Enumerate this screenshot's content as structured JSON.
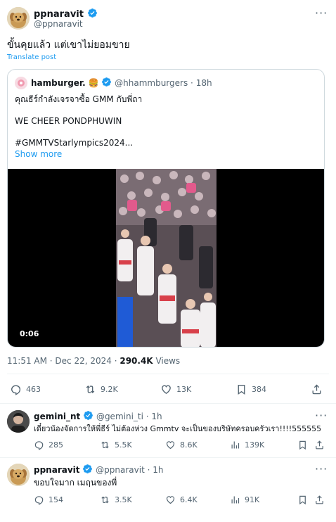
{
  "main_post": {
    "display_name": "ppnaravit",
    "handle": "@ppnaravit",
    "text": "ขั้นคุยแล้ว แต่เขาไม่ยอมขาย",
    "translate_label": "Translate post",
    "timestamp": "11:51 AM · Dec 22, 2024",
    "views_count": "290.4K",
    "views_label": "Views",
    "stats": {
      "replies": "463",
      "reposts": "9.2K",
      "likes": "13K",
      "bookmarks": "384"
    }
  },
  "quoted_post": {
    "display_name": "hamburger.",
    "emoji": "🍔",
    "handle": "@hhammburgers",
    "age": "18h",
    "line1": "คุณธีร์กำลังเจรจาซื้อ GMM กับพี่ถา",
    "line2": "WE CHEER PONDPHUWIN",
    "line3": "#GMMTVStarlympics2024...",
    "show_more": "Show more",
    "video_duration": "0:06"
  },
  "replies": [
    {
      "display_name": "gemini_nt",
      "handle": "@gemini_ti",
      "age": "1h",
      "text": "เดี๋ยวน้องจัดการให้พี่ธีร์ ไม่ต้องห่วง Gmmtv จะเป็นของบริษัทครอบครัวเรา!!!!555555",
      "stats": {
        "replies": "285",
        "reposts": "5.5K",
        "likes": "8.6K",
        "views": "139K"
      }
    },
    {
      "display_name": "ppnaravit",
      "handle": "@ppnaravit",
      "age": "1h",
      "text": "ขอบใจมาก เมฤนของพี่",
      "stats": {
        "replies": "154",
        "reposts": "3.5K",
        "likes": "6.4K",
        "views": "91K"
      }
    }
  ],
  "colors": {
    "accent": "#1d9bf0",
    "muted": "#536471",
    "border": "#cfd9de"
  }
}
